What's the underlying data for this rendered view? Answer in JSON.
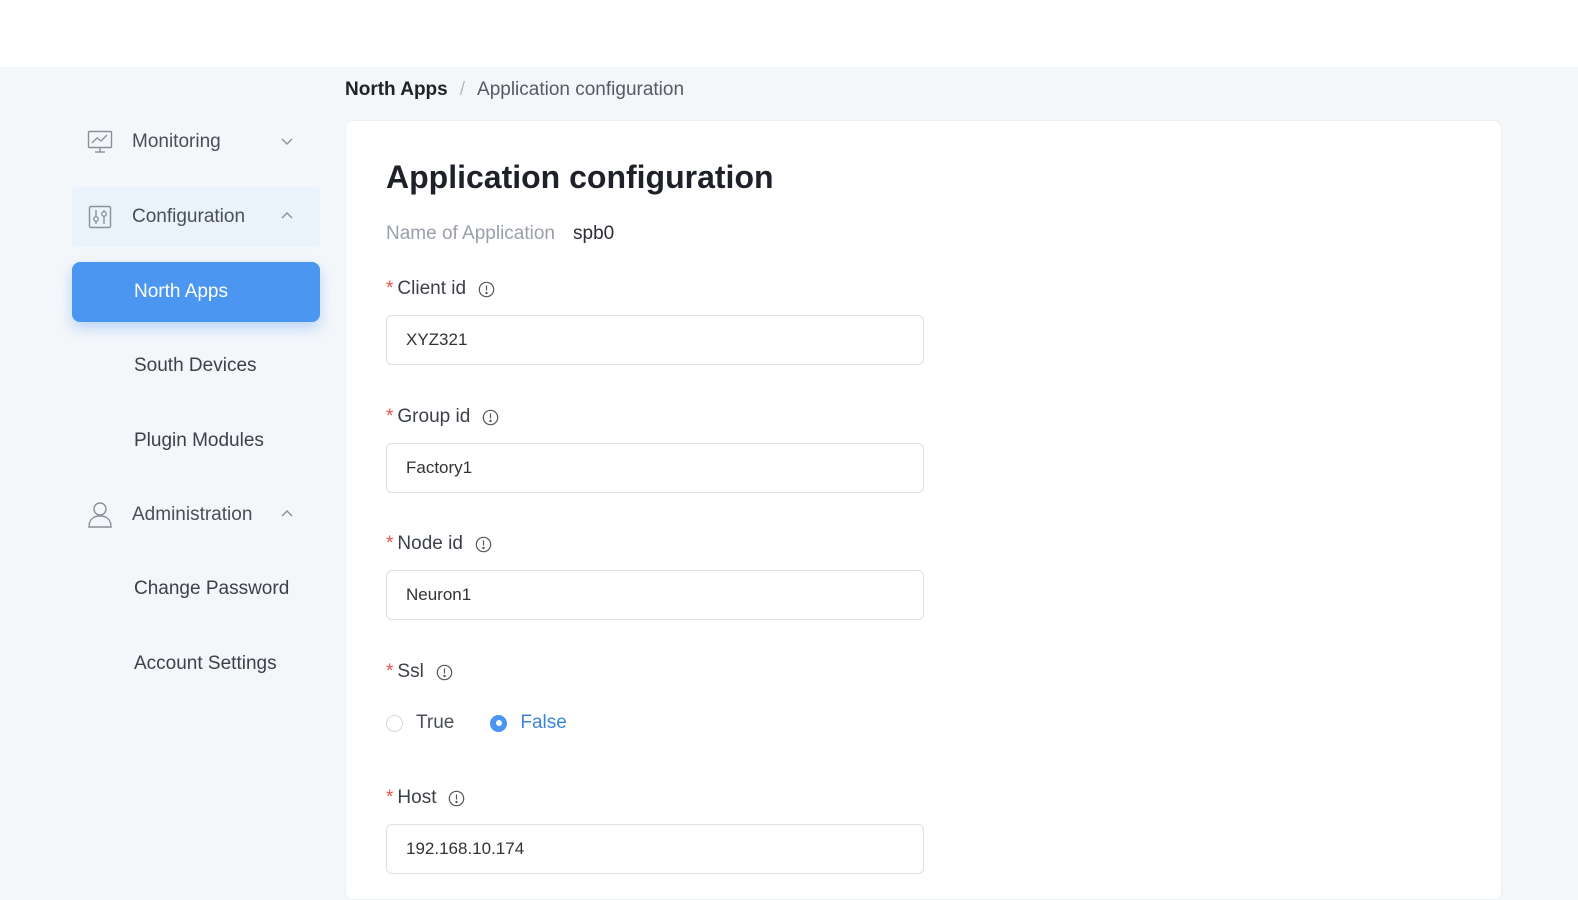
{
  "sidebar": {
    "groups": [
      {
        "label": "Monitoring",
        "icon": "monitor-chart-icon",
        "expanded": false
      },
      {
        "label": "Configuration",
        "icon": "sliders-icon",
        "expanded": true
      },
      {
        "label": "Administration",
        "icon": "user-icon",
        "expanded": true
      }
    ],
    "config_items": [
      {
        "label": "North Apps",
        "selected": true
      },
      {
        "label": "South Devices",
        "selected": false
      },
      {
        "label": "Plugin Modules",
        "selected": false
      }
    ],
    "admin_items": [
      {
        "label": "Change Password"
      },
      {
        "label": "Account Settings"
      }
    ]
  },
  "breadcrumb": {
    "root": "North Apps",
    "separator": "/",
    "current": "Application configuration"
  },
  "form": {
    "title": "Application configuration",
    "name_label": "Name of Application",
    "name_value": "spb0",
    "required_mark": "*",
    "client_id": {
      "label": "Client id",
      "value": "XYZ321"
    },
    "group_id": {
      "label": "Group id",
      "value": "Factory1"
    },
    "node_id": {
      "label": "Node id",
      "value": "Neuron1"
    },
    "ssl": {
      "label": "Ssl",
      "options": [
        {
          "label": "True",
          "checked": false
        },
        {
          "label": "False",
          "checked": true
        }
      ]
    },
    "host": {
      "label": "Host",
      "value": "192.168.10.174"
    }
  },
  "colors": {
    "accent": "#4a96f0",
    "required": "#e5534b",
    "background": "#f4f7fa"
  }
}
